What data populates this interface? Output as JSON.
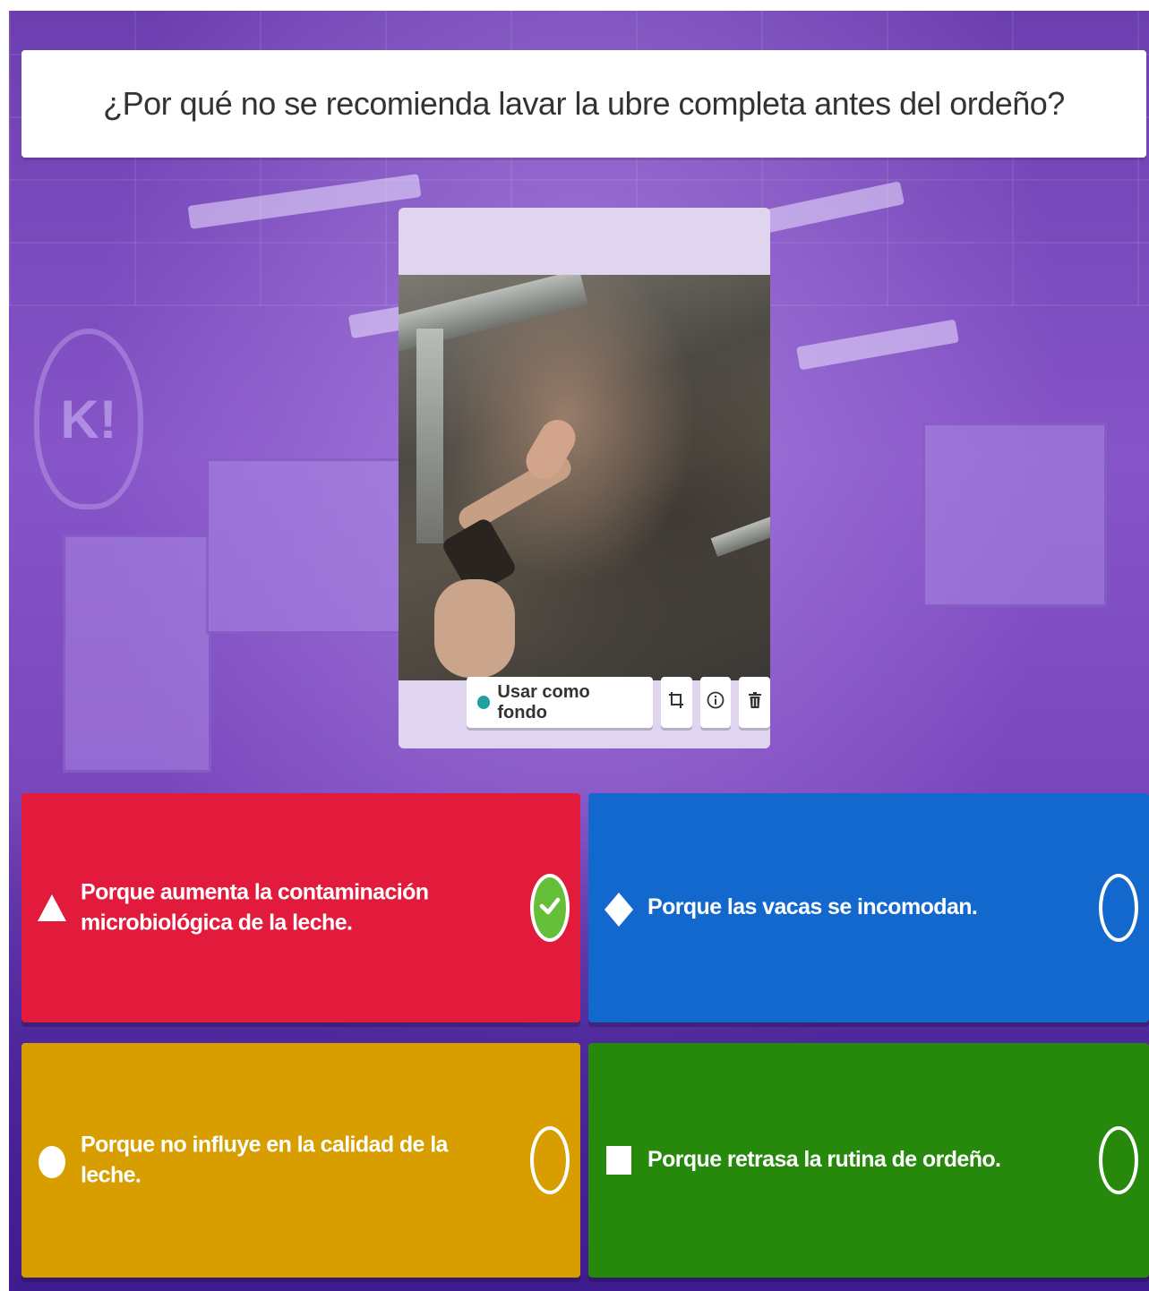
{
  "question": {
    "text": "¿Por qué no se recomienda lavar la ubre completa antes del ordeño?"
  },
  "media": {
    "toolbar": {
      "use_as_background_label": "Usar como fondo",
      "crop_icon": "crop-icon",
      "info_icon": "info-icon",
      "delete_icon": "trash-icon"
    }
  },
  "answers": [
    {
      "shape": "triangle",
      "color": "#e21b3c",
      "text": "Porque aumenta la contaminación microbiológica de la leche.",
      "correct": true
    },
    {
      "shape": "diamond",
      "color": "#1368ce",
      "text": "Porque las vacas se incomodan.",
      "correct": false
    },
    {
      "shape": "circle",
      "color": "#d89e00",
      "text": "Porque no influye en la calidad de la leche.",
      "correct": false
    },
    {
      "shape": "square",
      "color": "#26890c",
      "text": "Porque retrasa la rutina de ordeño.",
      "correct": false
    }
  ]
}
